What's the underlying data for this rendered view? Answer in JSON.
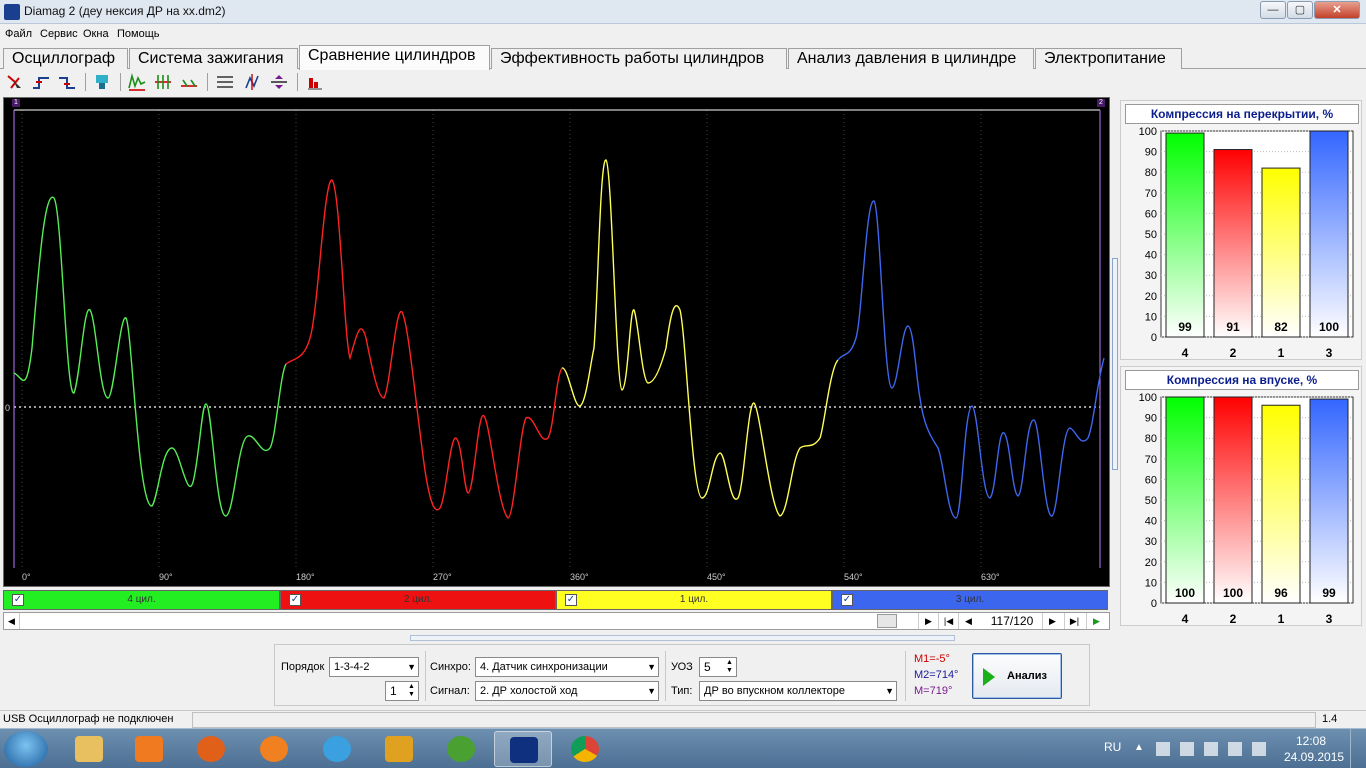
{
  "window": {
    "title": "Diamag 2 (деу нексия ДР на xx.dm2)",
    "controls": {
      "minimize": "—",
      "maximize": "▢",
      "close": "✕"
    }
  },
  "menu": [
    "Файл",
    "Сервис",
    "Окна",
    "Помощь"
  ],
  "tabs": [
    {
      "label": "Осциллограф",
      "active": false
    },
    {
      "label": "Система зажигания",
      "active": false
    },
    {
      "label": "Сравнение цилиндров",
      "active": true
    },
    {
      "label": "Эффективность работы цилиндров",
      "active": false
    },
    {
      "label": "Анализ давления в цилиндре",
      "active": false
    },
    {
      "label": "Электропитание",
      "active": false
    }
  ],
  "toolbar": {
    "icons": [
      "cursor-tool-icon",
      "rising-edge-icon",
      "falling-edge-icon",
      "cylinder-icon",
      "spark-marker-icon",
      "sync-marker-icon",
      "compress-marker-icon",
      "grid-lines-icon",
      "vertical-scale-icon",
      "horizontal-scale-icon",
      "bar-chart-icon"
    ]
  },
  "scope": {
    "zero_label": "0",
    "marker_left": "1",
    "marker_right": "2",
    "x_ticks": [
      "0°",
      "90°",
      "180°",
      "270°",
      "360°",
      "450°",
      "540°",
      "630°"
    ],
    "cylinders": [
      {
        "label": "4 цил.",
        "color": "#00ff00",
        "checked": true
      },
      {
        "label": "2 цил.",
        "color": "#ff0000",
        "checked": true
      },
      {
        "label": "1 цил.",
        "color": "#ffff00",
        "checked": true
      },
      {
        "label": "3 цил.",
        "color": "#3366ff",
        "checked": true
      }
    ]
  },
  "playback": {
    "frame_counter": "117/120",
    "buttons": [
      "play-icon",
      "first-frame-icon",
      "prev-frame-icon",
      "next-frame-icon",
      "last-frame-icon",
      "run-icon"
    ]
  },
  "chart_data": [
    {
      "type": "bar",
      "title": "Компрессия на перекрытии, %",
      "categories": [
        "4",
        "2",
        "1",
        "3"
      ],
      "values": [
        99,
        91,
        82,
        100
      ],
      "colors": [
        "#00ff00",
        "#ff0000",
        "#ffff00",
        "#3366ff"
      ],
      "ylim": [
        0,
        100
      ],
      "yticks": [
        "0",
        "10",
        "20",
        "30",
        "40",
        "50",
        "60",
        "70",
        "80",
        "90",
        "100"
      ]
    },
    {
      "type": "bar",
      "title": "Компрессия на впуске, %",
      "categories": [
        "4",
        "2",
        "1",
        "3"
      ],
      "values": [
        100,
        100,
        96,
        99
      ],
      "colors": [
        "#00ff00",
        "#ff0000",
        "#ffff00",
        "#3366ff"
      ],
      "ylim": [
        0,
        100
      ],
      "yticks": [
        "0",
        "10",
        "20",
        "30",
        "40",
        "50",
        "60",
        "70",
        "80",
        "90",
        "100"
      ]
    }
  ],
  "controls": {
    "order_label": "Порядок",
    "order_value": "1-3-4-2",
    "order_spin": "1",
    "sync_label": "Синхро:",
    "sync_value": "4.  Датчик синхронизации",
    "signal_label": "Сигнал:",
    "signal_value": "2.  ДР холостой ход",
    "uoz_label": "УОЗ",
    "uoz_value": "5",
    "type_label": "Тип:",
    "type_value": "ДР во впускном коллекторе",
    "m1": "M1=-5°",
    "m2": "M2=714°",
    "m3": "M=719°",
    "analyze": "Анализ"
  },
  "status": {
    "text": "USB Осциллограф не подключен",
    "version": "1.4"
  },
  "taskbar": {
    "lang": "RU",
    "time": "12:08",
    "date": "24.09.2015"
  }
}
